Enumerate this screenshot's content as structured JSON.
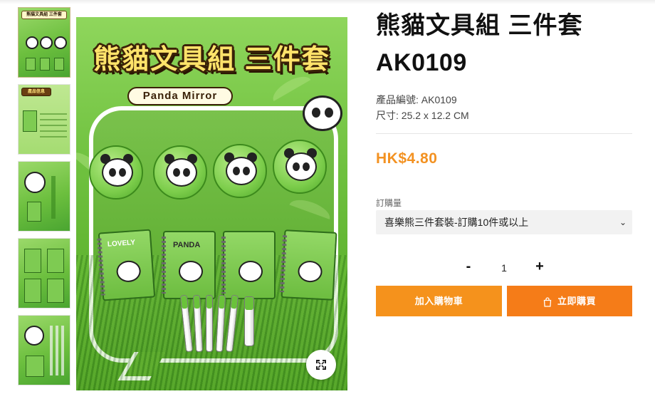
{
  "thumbnails": [
    {
      "banner": "熊貓文具組 三件套",
      "alt": "product-main"
    },
    {
      "banner": "產品信息",
      "alt": "product-info"
    },
    {
      "banner": "",
      "alt": "mirror-detail"
    },
    {
      "banner": "",
      "alt": "notebook-detail"
    },
    {
      "banner": "",
      "alt": "pen-detail"
    }
  ],
  "main_image": {
    "banner": "熊貓文具組 三件套",
    "label": "Panda Mirror",
    "notebook_tag": "PANDA",
    "notebook_tag2": "LOVELY"
  },
  "product": {
    "title": "熊貓文具組 三件套",
    "code_title": "AK0109",
    "sku": "產品編號: AK0109",
    "size": "尺寸: 25.2 x 12.2 CM",
    "price": "HK$4.80",
    "qty_label": "訂購量",
    "option_selected": "喜樂熊三件套裝-訂購10件或以上",
    "quantity": "1",
    "minus": "-",
    "plus": "+",
    "add_to_cart": "加入購物車",
    "buy_now": "立即購買"
  },
  "colors": {
    "price": "#f39222",
    "cart_button": "#f5921c",
    "buy_button": "#f57c18"
  },
  "icons": {
    "zoom": "expand-icon",
    "select": "chevron-down-icon",
    "buy": "shopping-bag-icon"
  }
}
